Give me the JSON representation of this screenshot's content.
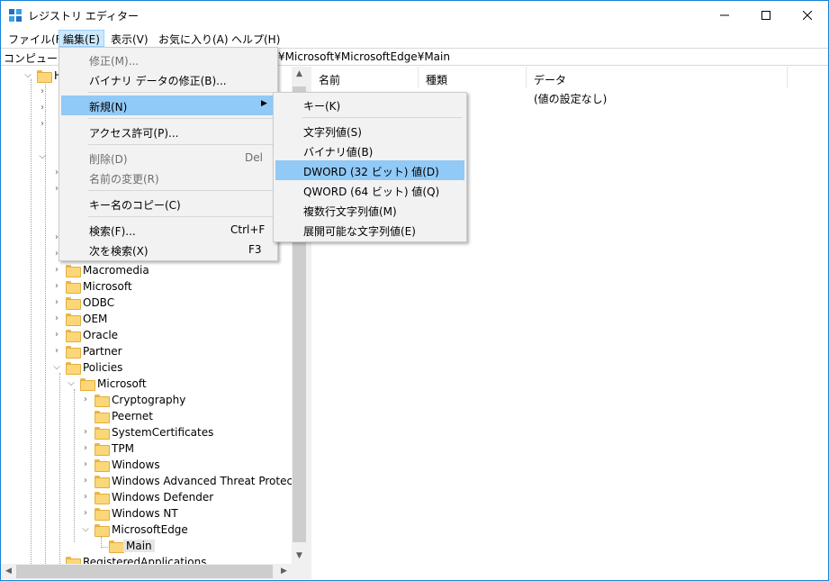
{
  "window": {
    "title": "レジストリ エディター",
    "controls": {
      "minimize": "minimize-icon",
      "maximize": "maximize-icon",
      "close": "close-icon"
    }
  },
  "menubar": {
    "file": "ファイル(F)",
    "edit": "編集(E)",
    "view": "表示(V)",
    "favorites": "お気に入り(A)",
    "help": "ヘルプ(H)"
  },
  "address": {
    "left": "コンピューター",
    "right": "¥Microsoft¥MicrosoftEdge¥Main"
  },
  "tree": {
    "partial_top": "H",
    "items": [
      {
        "label": "Macromedia"
      },
      {
        "label": "Microsoft"
      },
      {
        "label": "ODBC"
      },
      {
        "label": "OEM"
      },
      {
        "label": "Oracle"
      },
      {
        "label": "Partner"
      },
      {
        "label": "Policies"
      },
      {
        "label": "Microsoft"
      },
      {
        "label": "Cryptography"
      },
      {
        "label": "Peernet"
      },
      {
        "label": "SystemCertificates"
      },
      {
        "label": "TPM"
      },
      {
        "label": "Windows"
      },
      {
        "label": "Windows Advanced Threat Protection"
      },
      {
        "label": "Windows Defender"
      },
      {
        "label": "Windows NT"
      },
      {
        "label": "MicrosoftEdge"
      },
      {
        "label": "Main"
      },
      {
        "label": "RegisteredApplications"
      }
    ]
  },
  "list": {
    "columns": {
      "name": "名前",
      "type": "種類",
      "data": "データ"
    },
    "rows": [
      {
        "data": "(値の設定なし)"
      }
    ]
  },
  "edit_menu": {
    "modify": "修正(M)...",
    "modify_binary": "バイナリ データの修正(B)...",
    "new": "新規(N)",
    "permissions": "アクセス許可(P)...",
    "delete": "削除(D)",
    "delete_accel": "Del",
    "rename": "名前の変更(R)",
    "copy_key_name": "キー名のコピー(C)",
    "find": "検索(F)...",
    "find_accel": "Ctrl+F",
    "find_next": "次を検索(X)",
    "find_next_accel": "F3"
  },
  "new_submenu": {
    "key": "キー(K)",
    "string": "文字列値(S)",
    "binary": "バイナリ値(B)",
    "dword": "DWORD (32 ビット) 値(D)",
    "qword": "QWORD (64 ビット) 値(Q)",
    "multi_string": "複数行文字列値(M)",
    "expandable_string": "展開可能な文字列値(E)"
  },
  "colors": {
    "menu_highlight": "#91c9f7",
    "menubar_active": "#cce8ff",
    "window_border": "#1883d7",
    "folder": "#fcd779"
  }
}
